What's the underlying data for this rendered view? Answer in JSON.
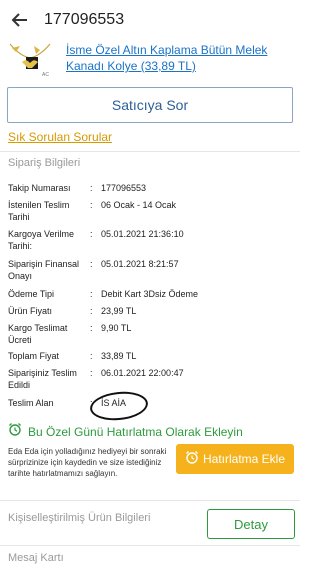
{
  "header": {
    "back_icon": "arrow-left-icon",
    "title": "177096553"
  },
  "product": {
    "name": "İsme Özel Altın Kaplama Bütün Melek Kanadı Kolye (33,89 TL)",
    "thumbnail_icon": "necklace-thumbnail-icon"
  },
  "ask_seller_label": "Satıcıya Sor",
  "faq_link": "Sık Sorulan Sorular",
  "order_info": {
    "title": "Sipariş Bilgileri",
    "rows": [
      {
        "label": "Takip Numarası",
        "value": "177096553"
      },
      {
        "label": "İstenilen Teslim Tarihi",
        "value": "06 Ocak - 14 Ocak"
      },
      {
        "label": "Kargoya Verilme Tarihi:",
        "value": "05.01.2021 21:36:10"
      },
      {
        "label": "Siparişin Finansal Onayı",
        "value": "05.01.2021 8:21:57"
      },
      {
        "label": "Ödeme Tipi",
        "value": "Debit Kart 3Dsiz Ödeme"
      },
      {
        "label": "Ürün Fiyatı",
        "value": "23,99 TL"
      },
      {
        "label": "Kargo Teslimat Ücreti",
        "value": "9,90 TL"
      },
      {
        "label": "Toplam Fiyat",
        "value": "33,89 TL"
      },
      {
        "label": "Siparişiniz Teslim Edildi",
        "value": "06.01.2021 22:00:47"
      },
      {
        "label": "Teslim Alan",
        "value": "İS AİA"
      }
    ],
    "separator": ":"
  },
  "reminder": {
    "icon": "alarm-clock-icon",
    "title": "Bu Özel Günü Hatırlatma Olarak Ekleyin",
    "description": "Eda Eda için yolladığınız hediyeyi bir sonraki sürprizinize için kaydedin ve size istediğiniz tarihte hatırlatmamızı sağlayın.",
    "button_label": "Hatırlatma Ekle"
  },
  "personalized": {
    "title": "Kişiselleştirilmiş Ürün Bilgileri",
    "detail_label": "Detay"
  },
  "message_card": {
    "title": "Mesaj Kartı"
  },
  "colors": {
    "accent_green": "#2e9a3e",
    "accent_orange": "#f6b21c",
    "link_blue": "#1a73c9",
    "faq_gold": "#d59a00"
  }
}
